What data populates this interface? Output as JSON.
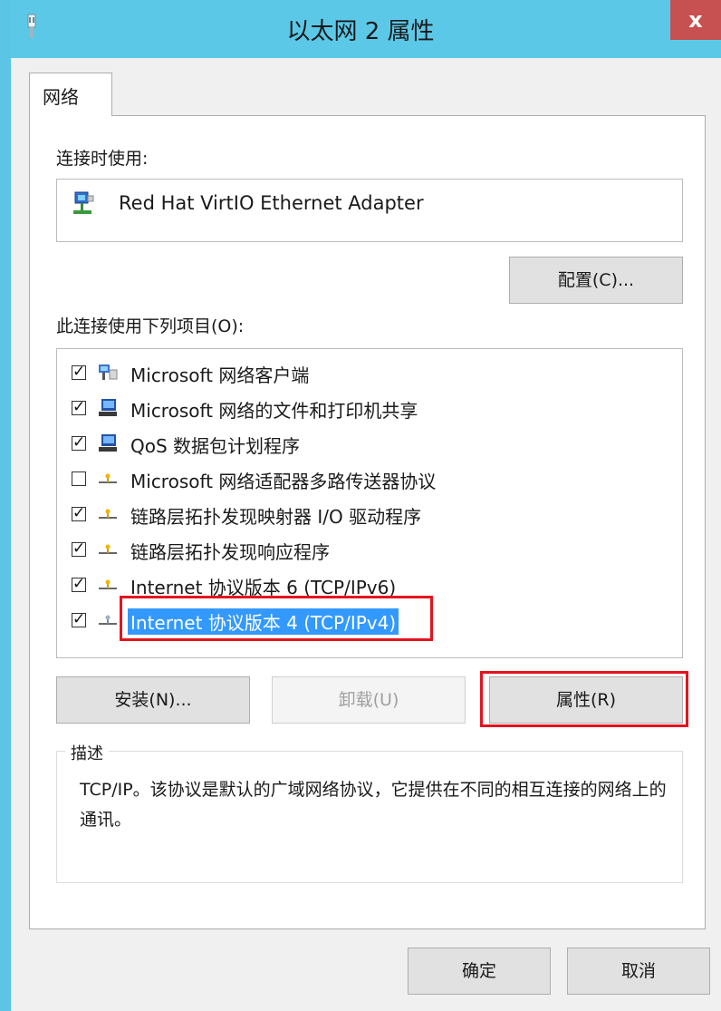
{
  "window": {
    "title": "以太网 2 属性",
    "close_label": "x"
  },
  "tabs": [
    {
      "label": "网络",
      "active": true
    }
  ],
  "connect_using": {
    "label": "连接时使用:",
    "adapter_name": "Red Hat VirtIO Ethernet Adapter",
    "adapter_icon": "network-adapter-icon",
    "configure_label": "配置(C)..."
  },
  "items_list": {
    "label": "此连接使用下列项目(O):",
    "items": [
      {
        "label": "Microsoft 网络客户端",
        "checked": true,
        "icon": "network-client-icon"
      },
      {
        "label": "Microsoft 网络的文件和打印机共享",
        "checked": true,
        "icon": "file-printer-sharing-icon"
      },
      {
        "label": "QoS 数据包计划程序",
        "checked": true,
        "icon": "qos-scheduler-icon"
      },
      {
        "label": "Microsoft 网络适配器多路传送器协议",
        "checked": false,
        "icon": "protocol-icon"
      },
      {
        "label": "链路层拓扑发现映射器 I/O 驱动程序",
        "checked": true,
        "icon": "protocol-icon"
      },
      {
        "label": "链路层拓扑发现响应程序",
        "checked": true,
        "icon": "protocol-icon"
      },
      {
        "label": "Internet 协议版本 6 (TCP/IPv6)",
        "checked": true,
        "icon": "protocol-icon"
      },
      {
        "label": "Internet 协议版本 4 (TCP/IPv4)",
        "checked": true,
        "icon": "protocol-icon",
        "selected": true
      }
    ]
  },
  "actions": {
    "install_label": "安装(N)...",
    "uninstall_label": "卸载(U)",
    "uninstall_disabled": true,
    "properties_label": "属性(R)"
  },
  "description": {
    "title": "描述",
    "text": "TCP/IP。该协议是默认的广域网络协议，它提供在不同的相互连接的网络上的通讯。"
  },
  "footer": {
    "ok_label": "确定",
    "cancel_label": "取消"
  },
  "colors": {
    "titlebar": "#5cc8e8",
    "close_button": "#c75050",
    "selection": "#3399ff",
    "highlight_outline": "#e5121e"
  }
}
